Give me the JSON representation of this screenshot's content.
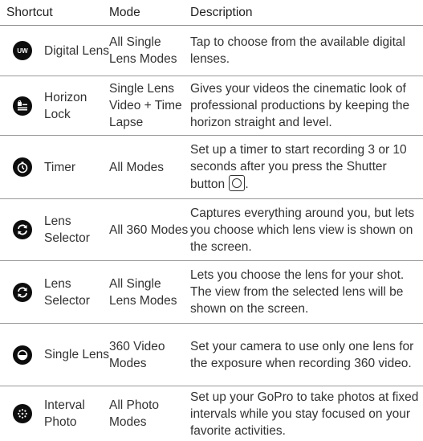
{
  "headers": {
    "shortcut": "Shortcut",
    "mode": "Mode",
    "description": "Description"
  },
  "rows": [
    {
      "icon": "uw-icon",
      "name": "Digital Lens",
      "mode": "All Single Lens Modes",
      "desc": "Tap to choose from the available digital lenses."
    },
    {
      "icon": "horizon-lock-icon",
      "name": "Horizon Lock",
      "mode": "Single Lens Video + Time Lapse",
      "desc": "Gives your videos the cinematic look of professional productions by keeping the horizon straight and level."
    },
    {
      "icon": "timer-icon",
      "name": "Timer",
      "mode": "All Modes",
      "desc": "Set up a timer to start recording 3 or 10 seconds after you press the Shutter button",
      "desc_tail": "."
    },
    {
      "icon": "lens-selector-icon",
      "name": "Lens Selector",
      "mode": "All 360 Modes",
      "desc": "Captures everything around you, but lets you choose which lens view is shown on the screen."
    },
    {
      "icon": "lens-selector-icon",
      "name": "Lens Selector",
      "mode": "All Single Lens Modes",
      "desc": "Lets you choose the lens for your shot. The view from the selected lens will be shown on the screen."
    },
    {
      "icon": "single-lens-icon",
      "name": "Single Lens",
      "mode": "360 Video Modes",
      "desc": "Set your camera to use only one lens for the exposure when recording 360 video."
    },
    {
      "icon": "interval-photo-icon",
      "name": "Interval Photo",
      "mode": "All Photo Modes",
      "desc": "Set up your GoPro to take photos at fixed intervals while you stay focused on your favorite activities."
    }
  ]
}
